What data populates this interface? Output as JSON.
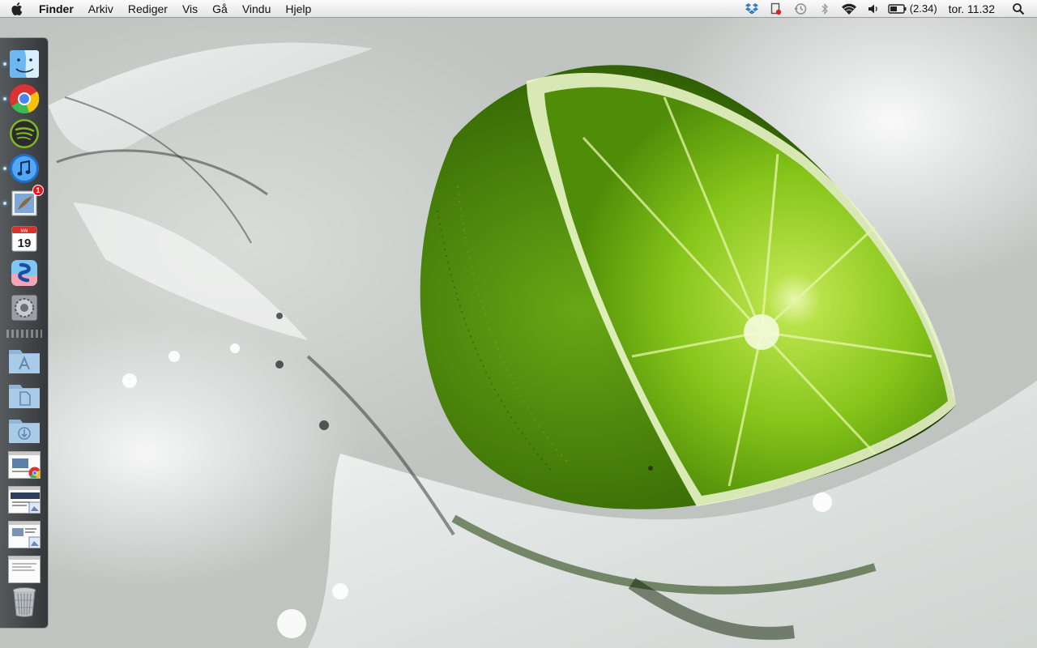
{
  "menubar": {
    "apple_icon": "apple-icon",
    "items": [
      {
        "label": "Finder",
        "bold": true
      },
      {
        "label": "Arkiv"
      },
      {
        "label": "Rediger"
      },
      {
        "label": "Vis"
      },
      {
        "label": "Gå"
      },
      {
        "label": "Vindu"
      },
      {
        "label": "Hjelp"
      }
    ],
    "tray": {
      "icons": [
        "dropbox-icon",
        "notification-icon",
        "time-machine-icon",
        "bluetooth-icon",
        "wifi-icon",
        "volume-icon",
        "battery-icon"
      ],
      "battery_text": "(2.34)",
      "clock": "tor. 11.32",
      "search_icon": "spotlight-search-icon"
    }
  },
  "dock": {
    "apps": [
      {
        "name": "finder-icon",
        "running": true
      },
      {
        "name": "chrome-icon",
        "running": true
      },
      {
        "name": "spotify-icon",
        "running": false
      },
      {
        "name": "itunes-icon",
        "running": true
      },
      {
        "name": "mail-icon",
        "running": true,
        "badge": "1"
      },
      {
        "name": "calendar-icon",
        "running": false,
        "month": "MAI",
        "day": "19"
      },
      {
        "name": "skitch-icon",
        "running": false
      },
      {
        "name": "system-preferences-icon",
        "running": false
      }
    ],
    "folders": [
      "applications-folder-icon",
      "documents-folder-icon",
      "downloads-folder-icon"
    ],
    "windows": [
      "chrome-window-thumbnail",
      "preview-window-thumbnail",
      "preview-window-thumbnail-2",
      "document-window-thumbnail"
    ],
    "trash": "trash-icon"
  },
  "wallpaper": {
    "accent_color": "#7fc31c",
    "dark_green": "#2f5a05"
  }
}
